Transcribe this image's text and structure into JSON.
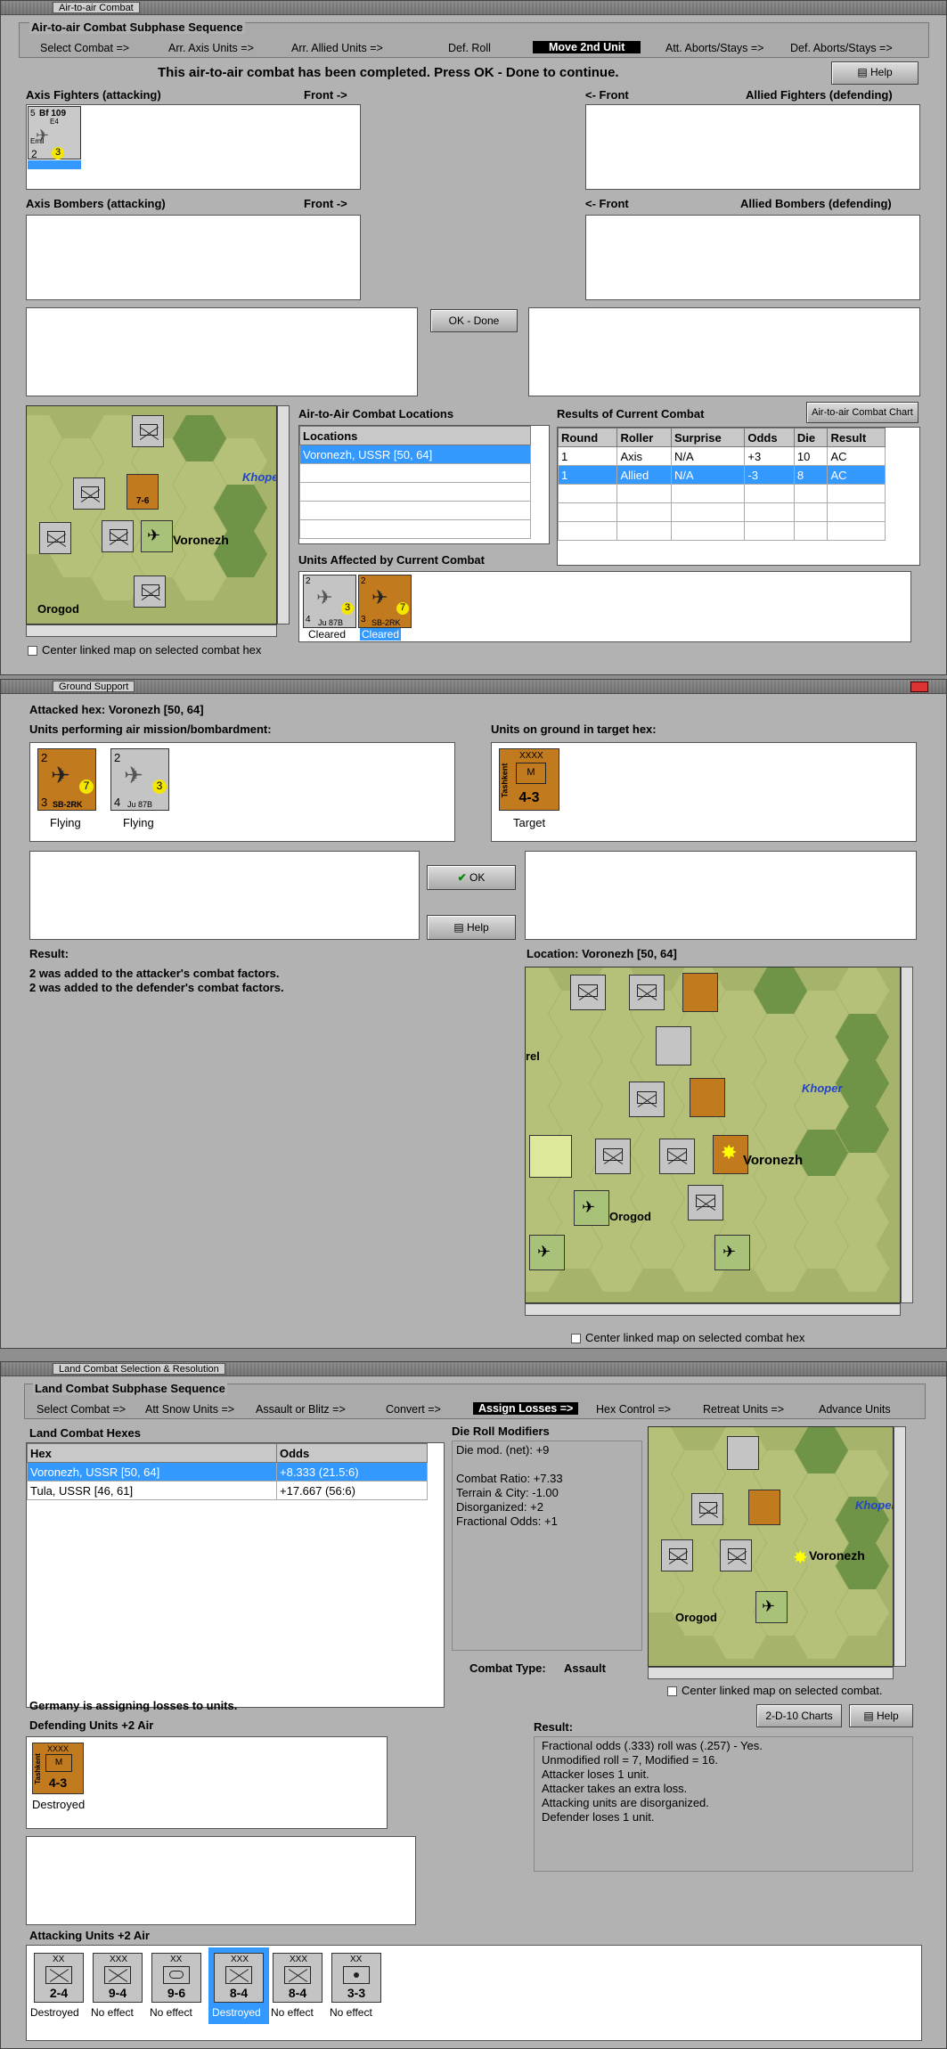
{
  "window1": {
    "title": "Air-to-air Combat",
    "group_title": "Air-to-air Combat Subphase Sequence",
    "phases": [
      "Select Combat =>",
      "Arr. Axis Units =>",
      "Arr. Allied Units =>",
      "Def. Roll",
      "Move 2nd Unit",
      "Att. Aborts/Stays =>",
      "Def. Aborts/Stays =>"
    ],
    "active_phase": "Move 2nd Unit",
    "message": "This air-to-air combat has been completed.  Press OK - Done to continue.",
    "help_label": "Help",
    "axis_fighters_label": "Axis Fighters (attacking)",
    "front_right": "Front ->",
    "front_left": "<- Front",
    "allied_fighters_label": "Allied Fighters (defending)",
    "axis_bombers_label": "Axis Bombers (attacking)",
    "allied_bombers_label": "Allied Bombers (defending)",
    "ok_done_label": "OK - Done",
    "fighter_unit": {
      "name": "Bf 109",
      "sub": "E4",
      "pilot": "Emil",
      "left": "5",
      "a": "2",
      "b": "3"
    },
    "locations_title": "Air-to-Air Combat Locations",
    "locations_header": "Locations",
    "locations": [
      "Voronezh, USSR [50, 64]"
    ],
    "results_title": "Results of Current Combat",
    "chart_button": "Air-to-air Combat Chart",
    "results_headers": [
      "Round",
      "Roller",
      "Surprise",
      "Odds",
      "Die",
      "Result"
    ],
    "results_rows": [
      [
        "1",
        "Axis",
        "N/A",
        "+3",
        "10",
        "AC"
      ],
      [
        "1",
        "Allied",
        "N/A",
        "-3",
        "8",
        "AC"
      ]
    ],
    "affected_title": "Units Affected by Current Combat",
    "affected": [
      {
        "name": "Ju 87B",
        "a": "2",
        "b": "4",
        "c": "3",
        "caption": "Cleared"
      },
      {
        "name": "SB-2RK",
        "a": "2",
        "b": "3",
        "c": "7",
        "caption": "Cleared"
      }
    ],
    "center_linked": "Center linked map on selected combat hex",
    "map_labels": {
      "city": "Voronezh",
      "river": "Khoper",
      "town": "Orogod"
    }
  },
  "window2": {
    "title": "Ground Support",
    "attacked_hex": "Attacked hex: Voronezh  [50, 64]",
    "air_label": "Units performing air mission/bombardment:",
    "ground_label": "Units on ground in target hex:",
    "air_units": [
      {
        "name": "SB-2RK",
        "a": "2",
        "b": "3",
        "c": "7",
        "caption": "Flying"
      },
      {
        "name": "Ju 87B",
        "a": "2",
        "b": "4",
        "c": "3",
        "caption": "Flying"
      }
    ],
    "ground_unit": {
      "name": "Tashkent",
      "size": "XXXX",
      "value": "4-3",
      "caption": "Target"
    },
    "ok_label": "OK",
    "help_label": "Help",
    "result_label": "Result:",
    "result_lines": [
      "2 was added to the attacker's combat factors.",
      "2 was added to the defender's combat factors."
    ],
    "location": "Location:  Voronezh  [50, 64]",
    "center_linked": "Center linked map on selected combat hex",
    "map_labels": {
      "city": "Voronezh",
      "river": "Khoper",
      "town": "Orogod",
      "rel": "rel"
    }
  },
  "window3": {
    "title": "Land Combat Selection & Resolution",
    "group_title": "Land Combat Subphase Sequence",
    "phases": [
      "Select Combat =>",
      "Att Snow Units =>",
      "Assault or Blitz =>",
      "Convert =>",
      "Assign Losses =>",
      "Hex Control =>",
      "Retreat Units =>",
      "Advance Units"
    ],
    "active_phase": "Assign Losses =>",
    "hexes_title": "Land Combat Hexes",
    "hex_headers": [
      "Hex",
      "Odds"
    ],
    "hex_rows": [
      [
        "Voronezh, USSR [50, 64]",
        "+8.333 (21.5:6)"
      ],
      [
        "Tula, USSR [46, 61]",
        "+17.667 (56:6)"
      ]
    ],
    "die_title": "Die Roll Modifiers",
    "die_lines": [
      "Die mod. (net): +9",
      "",
      "Combat Ratio: +7.33",
      "Terrain & City: -1.00",
      "Disorganized: +2",
      "Fractional Odds: +1"
    ],
    "combat_type_label": "Combat Type:",
    "combat_type": "Assault",
    "center_linked": "Center linked map on selected combat.",
    "charts_button": "2-D-10 Charts",
    "help_label": "Help",
    "assigning": "Germany is assigning losses to units.",
    "defending_label": "Defending Units +2 Air",
    "defending_unit": {
      "name": "Tashkent",
      "size": "XXXX",
      "value": "4-3",
      "caption": "Destroyed"
    },
    "result_label": "Result:",
    "result_lines": [
      "Fractional odds (.333) roll was (.257)  - Yes.",
      "Unmodified roll = 7, Modified = 16.",
      "Attacker loses 1 unit.",
      "Attacker takes an extra loss.",
      "Attacking units are disorganized.",
      "Defender loses 1 unit."
    ],
    "attacking_label": "Attacking Units +2 Air",
    "attacking_units": [
      {
        "value": "2-4",
        "size": "XX",
        "caption": "Destroyed"
      },
      {
        "value": "9-4",
        "size": "XXX",
        "caption": "No effect"
      },
      {
        "value": "9-6",
        "size": "XX",
        "caption": "No effect"
      },
      {
        "value": "8-4",
        "size": "XXX",
        "caption": "Destroyed"
      },
      {
        "value": "8-4",
        "size": "XXX",
        "caption": "No effect"
      },
      {
        "value": "3-3",
        "size": "XX",
        "caption": "No effect"
      }
    ],
    "map_labels": {
      "city": "Voronezh",
      "river": "Khoper",
      "town": "Orogod"
    }
  },
  "colors": {
    "selection": "#3399ff",
    "soviet_unit": "#c17a1e",
    "german_unit": "#c4c4c4",
    "window_bg": "#b2b2b2"
  }
}
